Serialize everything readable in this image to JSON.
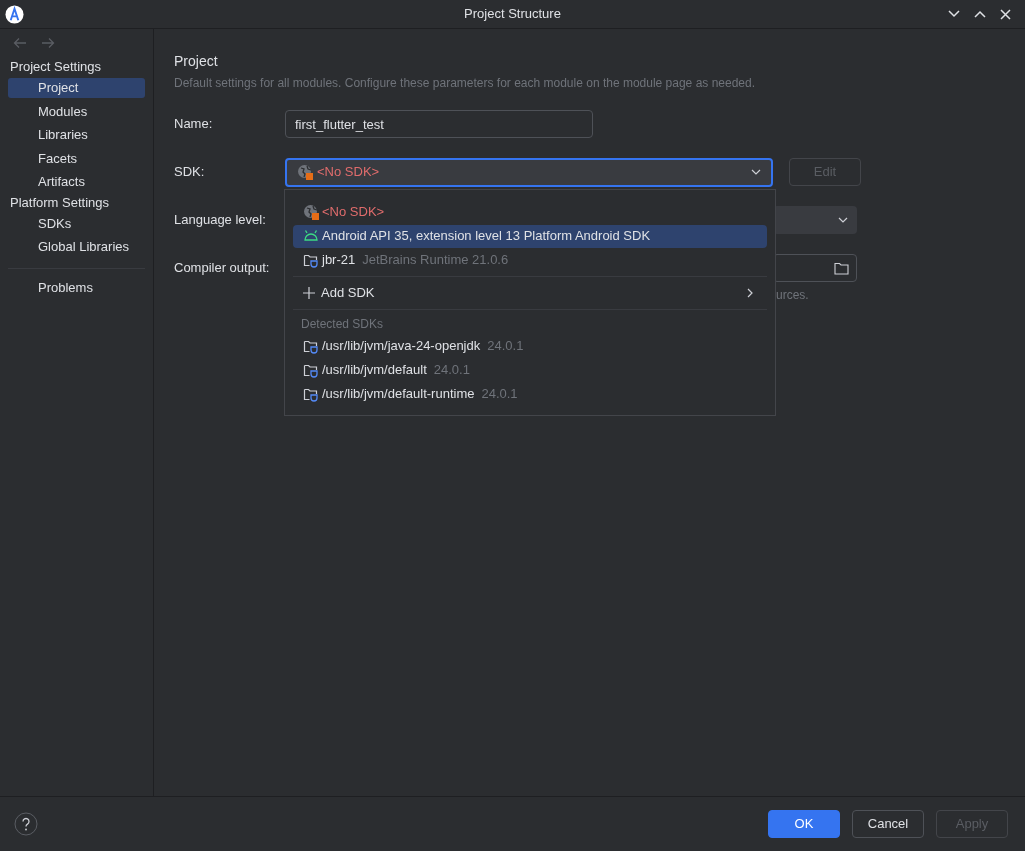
{
  "window": {
    "title": "Project Structure"
  },
  "sidebar": {
    "sections": [
      {
        "heading": "Project Settings",
        "items": [
          {
            "label": "Project",
            "selected": true
          },
          {
            "label": "Modules",
            "selected": false
          },
          {
            "label": "Libraries",
            "selected": false
          },
          {
            "label": "Facets",
            "selected": false
          },
          {
            "label": "Artifacts",
            "selected": false
          }
        ]
      },
      {
        "heading": "Platform Settings",
        "items": [
          {
            "label": "SDKs",
            "selected": false
          },
          {
            "label": "Global Libraries",
            "selected": false
          }
        ]
      }
    ],
    "problems": {
      "label": "Problems",
      "selected": false
    }
  },
  "main": {
    "title": "Project",
    "description": "Default settings for all modules. Configure these parameters for each module on the module page as needed.",
    "name": {
      "label": "Name:",
      "value": "first_flutter_test"
    },
    "sdk": {
      "label": "SDK:",
      "value": "<No SDK>",
      "invalid": true,
      "edit_button": "Edit",
      "edit_disabled": true
    },
    "language_level": {
      "label": "Language level:"
    },
    "compiler_output": {
      "label": "Compiler output:",
      "hint": "urces."
    }
  },
  "sdk_popup": {
    "items": [
      {
        "kind": "none",
        "name": "<No SDK>",
        "invalid": true,
        "selected": false
      },
      {
        "kind": "android",
        "name": "Android API 35, extension level 13 Platform Android SDK",
        "invalid": false,
        "selected": true
      },
      {
        "kind": "jdk",
        "name": "jbr-21",
        "detail": "JetBrains Runtime 21.0.6",
        "invalid": false,
        "selected": false
      }
    ],
    "add_sdk": "Add SDK",
    "detected": {
      "heading": "Detected SDKs",
      "items": [
        {
          "kind": "jdk",
          "name": "/usr/lib/jvm/java-24-openjdk",
          "detail": "24.0.1",
          "selected": false
        },
        {
          "kind": "jdk",
          "name": "/usr/lib/jvm/default",
          "detail": "24.0.1",
          "selected": false
        },
        {
          "kind": "jdk",
          "name": "/usr/lib/jvm/default-runtime",
          "detail": "24.0.1",
          "selected": false
        }
      ]
    }
  },
  "buttons": [
    {
      "label": "OK",
      "kind": "primary"
    },
    {
      "label": "Cancel",
      "kind": "normal",
      "disabled": false
    },
    {
      "label": "Apply",
      "kind": "normal",
      "disabled": true
    }
  ]
}
